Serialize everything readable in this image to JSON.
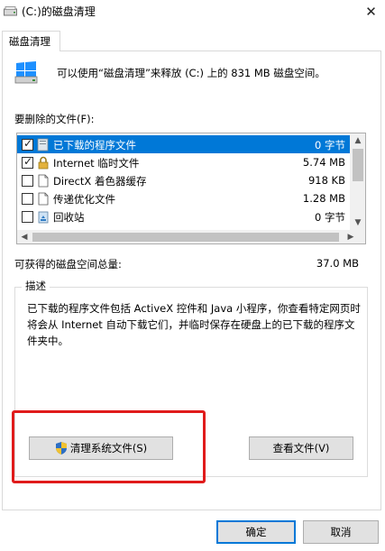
{
  "window": {
    "title": "(C:)的磁盘清理",
    "close_glyph": "✕"
  },
  "tabs": [
    {
      "label": "磁盘清理"
    }
  ],
  "header": {
    "text": "可以使用“磁盘清理”来释放  (C:) 上的 831 MB 磁盘空间。"
  },
  "files_label": "要删除的文件(F):",
  "files": [
    {
      "name": "已下载的程序文件",
      "size": "0 字节",
      "checked": true,
      "selected": true,
      "icon": "folder-icon"
    },
    {
      "name": "Internet 临时文件",
      "size": "5.74 MB",
      "checked": true,
      "selected": false,
      "icon": "lock-icon"
    },
    {
      "name": "DirectX 着色器缓存",
      "size": "918 KB",
      "checked": false,
      "selected": false,
      "icon": "document-icon"
    },
    {
      "name": "传递优化文件",
      "size": "1.28 MB",
      "checked": false,
      "selected": false,
      "icon": "document-icon"
    },
    {
      "name": "回收站",
      "size": "0 字节",
      "checked": false,
      "selected": false,
      "icon": "recycle-bin-icon"
    }
  ],
  "space": {
    "label": "可获得的磁盘空间总量:",
    "value": "37.0 MB"
  },
  "description": {
    "legend": "描述",
    "text": "已下载的程序文件包括 ActiveX 控件和 Java 小程序，你查看特定网页时将会从 Internet 自动下载它们，并临时保存在硬盘上的已下载的程序文件夹中。"
  },
  "buttons": {
    "cleanup_system": "清理系统文件(S)",
    "view_files": "查看文件(V)",
    "ok": "确定",
    "cancel": "取消"
  },
  "colors": {
    "selection": "#0078d7",
    "highlight_box": "#e01b1b"
  }
}
